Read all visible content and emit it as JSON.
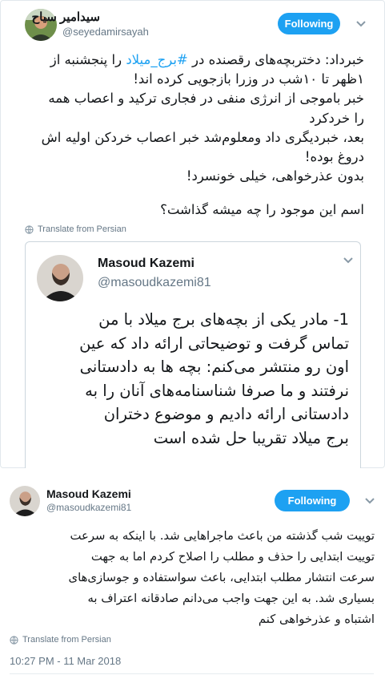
{
  "top_tweet": {
    "author": {
      "name": "سیدامیر سیاح",
      "handle": "@seyedamirsayah"
    },
    "follow_label": "Following",
    "text_lines": [
      "خبرداد: دختربچه‌های رقصنده در #برج_میلاد را پنجشنبه از",
      "۱ظهر تا ۱۰شب در وزرا بازجویی کرده اند!",
      "خبر باموجی از انرژی منفی در فجاری ترکید و اعصاب همه",
      "را خردکرد",
      "بعد، خبردیگری داد ومعلوم‌شد خبر اعصاب خردکن اولیه اش",
      "دروغ بوده!",
      "بدون عذرخواهی، خیلی خونسرد!",
      "",
      "اسم این موجود را چه میشه گذاشت؟"
    ],
    "translate_label": "Translate from Persian",
    "quoted": {
      "name": "Masoud Kazemi",
      "handle": "@masoudkazemi81",
      "text_lines": [
        "1- مادر یکی از بچه‌های برج میلاد با من",
        "تماس گرفت و توضیحاتی ارائه داد که عین",
        "اون رو منتشر می‌کنم: بچه ها به دادستانی",
        "نرفتند و ما صرفا شناسنامه‌های آنان را به",
        "دادستانی ارائه دادیم و موضوع دختران",
        "برج میلاد تقریبا حل شده است"
      ]
    }
  },
  "bottom_tweet": {
    "author": {
      "name": "Masoud Kazemi",
      "handle": "@masoudkazemi81"
    },
    "follow_label": "Following",
    "text_lines": [
      "توییت شب گذشته من باعث ماجراهایی شد. با اینکه به سرعت",
      "توییت ابتدایی را حذف و مطلب را اصلاح کردم اما به جهت",
      "سرعت انتشار مطلب ابتدایی، باعث سواستفاده و جوسازی‌های",
      "بسیاری شد. به این جهت واجب می‌دانم صادقانه اعتراف به",
      "اشتباه و عذرخواهی کنم"
    ],
    "translate_label": "Translate from Persian",
    "timestamp": "10:27 PM - 11 Mar 2018"
  },
  "colors": {
    "accent": "#1da1f2",
    "text": "#14171a",
    "muted": "#657786",
    "border": "#e1e8ed"
  },
  "icons": [
    "avatar-photo",
    "chevron-down-icon",
    "globe-icon"
  ]
}
